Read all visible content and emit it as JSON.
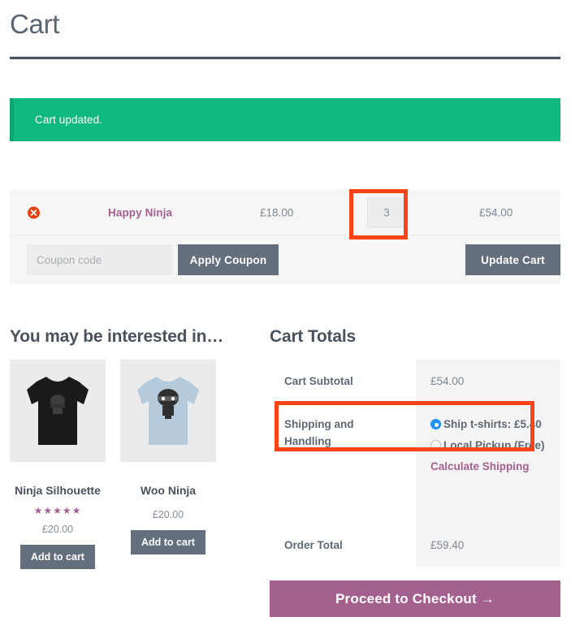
{
  "page": {
    "title": "Cart"
  },
  "notice": {
    "message": "Cart updated.",
    "color": "#0fb97d"
  },
  "cart_table": {
    "rows": [
      {
        "remove_label": "×",
        "product": "Happy Ninja",
        "unit_price": "£18.00",
        "quantity": "3",
        "line_total": "£54.00"
      }
    ]
  },
  "coupon": {
    "placeholder": "Coupon code",
    "value": "",
    "apply_label": "Apply Coupon",
    "update_label": "Update Cart"
  },
  "cross_sells": {
    "heading": "You may be interested in…",
    "products": [
      {
        "name": "Ninja Silhouette",
        "price": "£20.00",
        "rating": "★★★★★",
        "add_label": "Add to cart",
        "shirt_color": "#1a1a1a"
      },
      {
        "name": "Woo Ninja",
        "price": "£20.00",
        "rating": "",
        "add_label": "Add to cart",
        "shirt_color": "#b5cadb"
      }
    ]
  },
  "totals": {
    "heading": "Cart Totals",
    "subtotal_label": "Cart Subtotal",
    "subtotal_value": "£54.00",
    "shipping_label": "Shipping and Handling",
    "shipping_options": [
      {
        "label": "Ship t-shirts: £5.40",
        "selected": true
      },
      {
        "label": "Local Pickup (Free)",
        "selected": false
      }
    ],
    "calculate_shipping_label": "Calculate Shipping",
    "order_total_label": "Order Total",
    "order_total_value": "£59.40",
    "checkout_label": "Proceed to Checkout  →"
  },
  "annotations": {
    "color": "#fa4417",
    "targets": [
      "quantity-input",
      "shipping-and-handling-row"
    ]
  }
}
